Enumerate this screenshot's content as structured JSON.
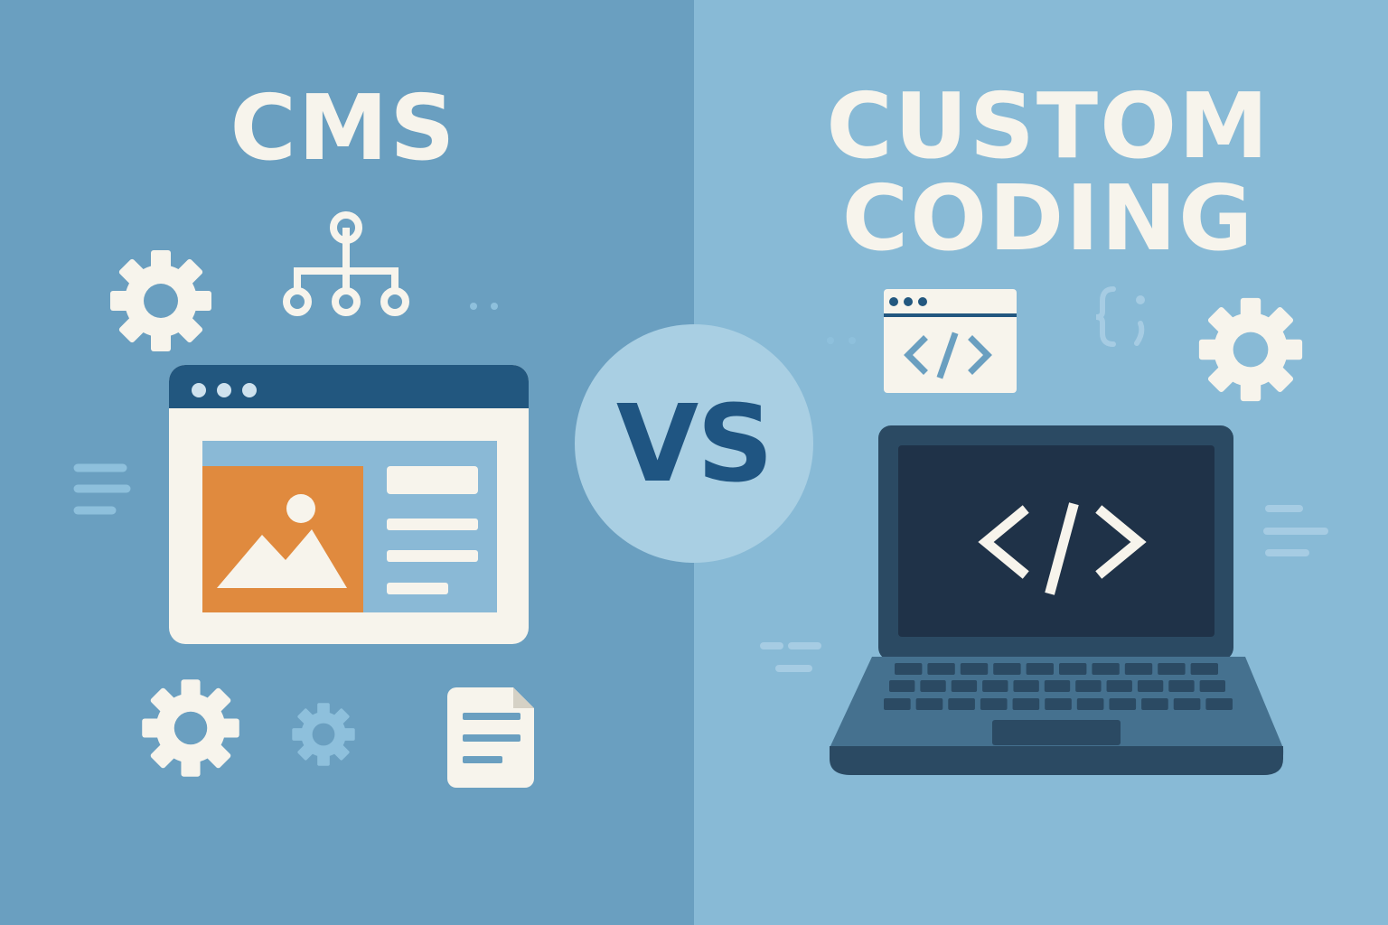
{
  "titles": {
    "left": "CMS",
    "right_line1": "CUSTOM",
    "right_line2": "CODING",
    "center": "VS"
  },
  "icons": {
    "browser_code_window": "code-icon",
    "laptop_screen": "code-icon",
    "braces": "braces-icon",
    "gears": "gear-icon",
    "sitemap": "sitemap-icon",
    "document": "document-icon",
    "image_placeholder": "image-icon"
  },
  "colors": {
    "left_background": "#6a9fc0",
    "right_background": "#88bad6",
    "vs_circle": "#a9cfe3",
    "vs_text": "#1f5582",
    "title_text": "#f7f4ec",
    "browser_bar": "#22577f",
    "image_placeholder": "#e08a3e",
    "laptop_body": "#2b4a63",
    "laptop_screen": "#1f3248"
  }
}
